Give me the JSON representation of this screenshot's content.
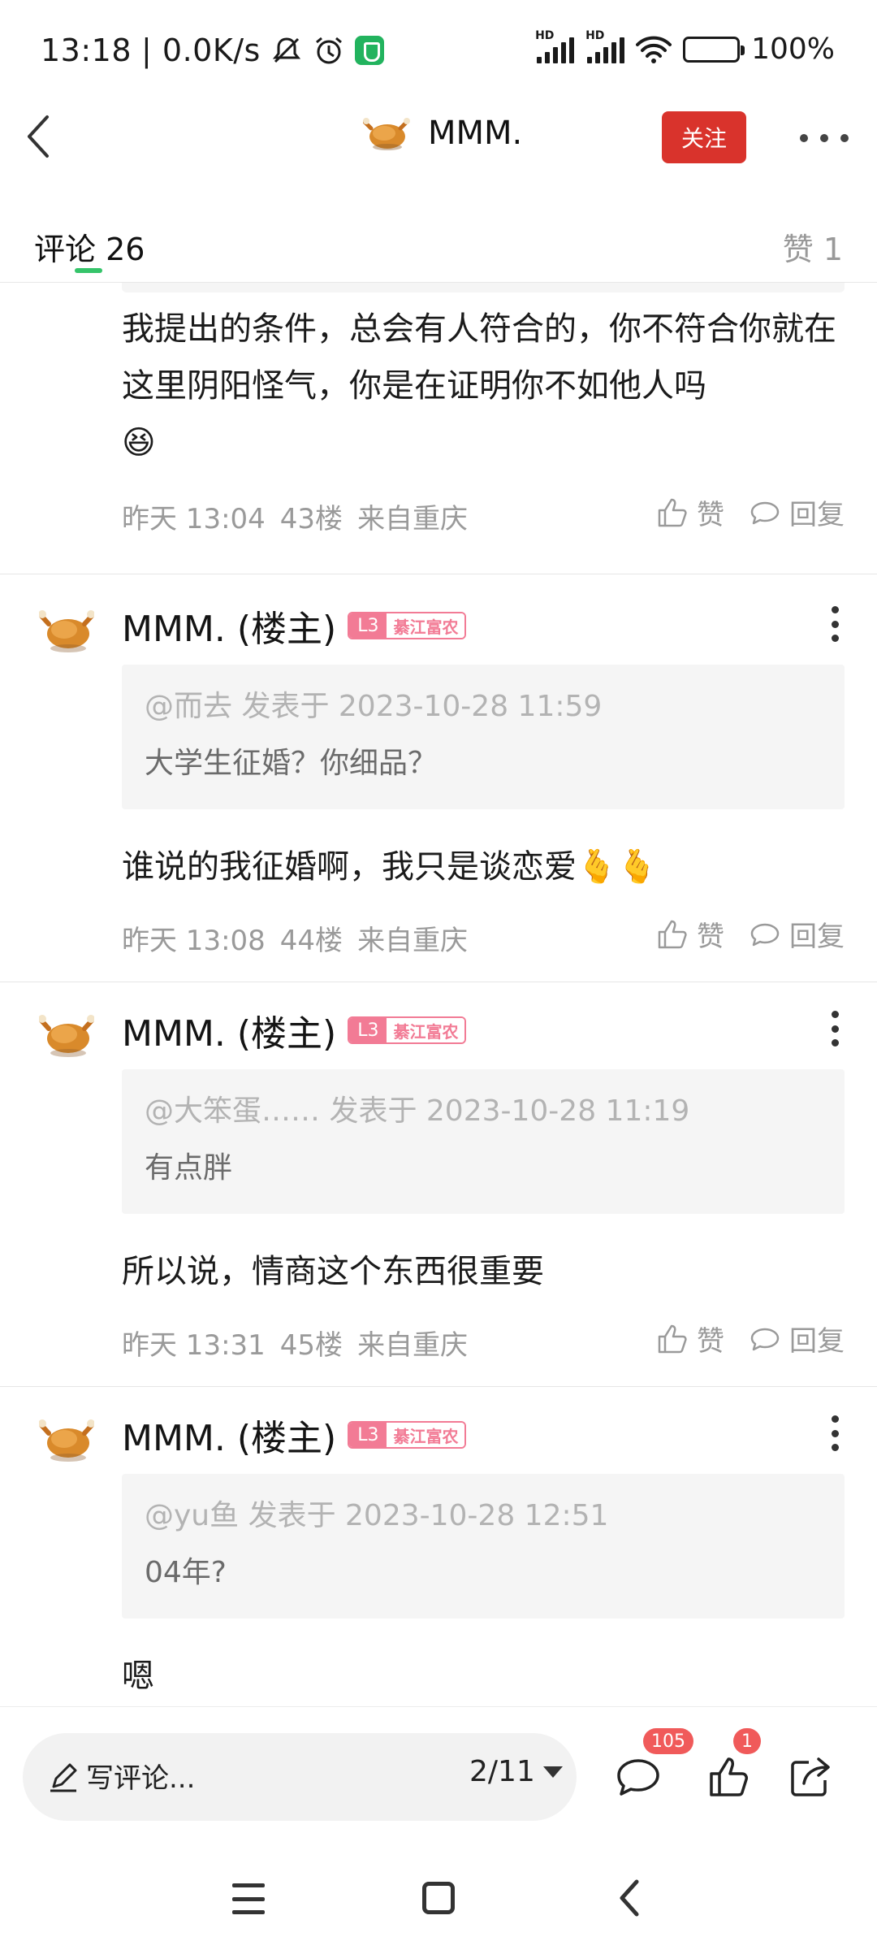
{
  "status_bar": {
    "time": "13:18",
    "speed": "| 0.0K/s",
    "hd1": "HD",
    "hd2": "HD",
    "battery": "100%",
    "icons": [
      "mute-icon",
      "alarm-icon",
      "shield-icon",
      "signal-icon",
      "signal-icon",
      "wifi-icon",
      "battery-icon"
    ]
  },
  "nav": {
    "title": "MMM.",
    "follow_label": "关注"
  },
  "tabs": {
    "comments_label": "评论",
    "comments_count": "26",
    "likes_label": "赞 1"
  },
  "comments": [
    {
      "text": "我提出的条件，总会有人符合的，你不符合你就在这里阴阳怪气，你是在证明你不如他人吗",
      "emoji": "😆",
      "time": "昨天 13:04",
      "floor": "43楼",
      "location": "来自重庆",
      "like_label": "赞",
      "reply_label": "回复"
    },
    {
      "author": "MMM. (楼主)",
      "level": "L3",
      "title": "綦江富农",
      "quote_meta": "@而去 发表于 2023-10-28 11:59",
      "quote_text": "大学生征婚？你细品？",
      "text": "谁说的我征婚啊，我只是谈恋爱",
      "emoji": "🫰🫰",
      "time": "昨天 13:08",
      "floor": "44楼",
      "location": "来自重庆",
      "like_label": "赞",
      "reply_label": "回复"
    },
    {
      "author": "MMM. (楼主)",
      "level": "L3",
      "title": "綦江富农",
      "quote_meta": "@大笨蛋…… 发表于 2023-10-28 11:19",
      "quote_text": "有点胖",
      "text": "所以说，情商这个东西很重要",
      "time": "昨天 13:31",
      "floor": "45楼",
      "location": "来自重庆",
      "like_label": "赞",
      "reply_label": "回复"
    },
    {
      "author": "MMM. (楼主)",
      "level": "L3",
      "title": "綦江富农",
      "quote_meta": "@yu鱼 发表于 2023-10-28 12:51",
      "quote_text": "04年?",
      "text": "嗯"
    }
  ],
  "bottom_bar": {
    "input_placeholder": "写评论...",
    "page": "2/11",
    "comment_badge": "105",
    "like_badge": "1"
  },
  "colors": {
    "accent_red": "#d9332c",
    "tab_green": "#35c46a",
    "level_pink": "#f27b95",
    "badge_red": "#f05a5a"
  }
}
